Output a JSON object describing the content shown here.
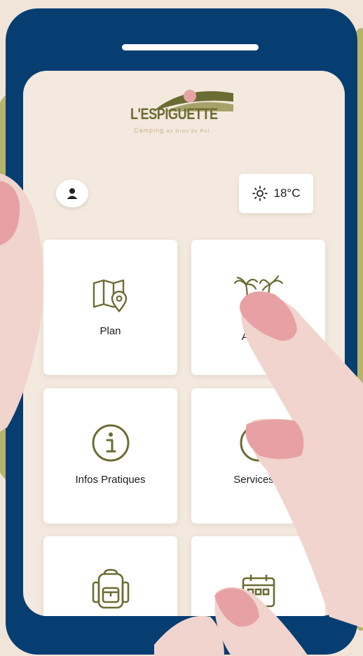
{
  "brand": {
    "name": "L'ESPIGUETTE",
    "tagline_word": "Camping",
    "tagline_rest": "au Grau du Roi"
  },
  "weather": {
    "icon": "sun-icon",
    "temperature": "18°C"
  },
  "account": {
    "icon": "user-icon"
  },
  "tiles": [
    {
      "label": "Plan",
      "icon": "map-pin-icon"
    },
    {
      "label": "Arrivée",
      "icon": "palm-trees-icon"
    },
    {
      "label": "Infos Pratiques",
      "icon": "info-icon"
    },
    {
      "label": "Services +",
      "icon": "services-icon"
    },
    {
      "label": "",
      "icon": "backpack-icon"
    },
    {
      "label": "",
      "icon": "calendar-icon"
    }
  ],
  "colors": {
    "phone": "#063e72",
    "screen": "#f4e9de",
    "olive": "#6b6c34",
    "skin": "#f1d4cd",
    "nail": "#e7a1a5"
  }
}
